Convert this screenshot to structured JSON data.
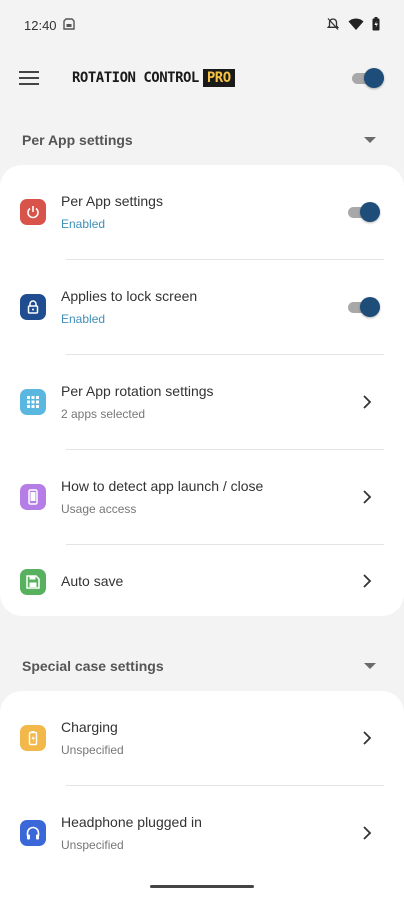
{
  "status": {
    "time": "12:40",
    "left_icon": "sd-card-icon",
    "right_icons": [
      "notifications-off-icon",
      "wifi-icon",
      "battery-icon"
    ]
  },
  "app_bar": {
    "menu_icon": "hamburger-menu-icon",
    "logo_text": "ROTATION CONTROL",
    "logo_badge": "PRO",
    "master_switch_on": true
  },
  "colors": {
    "switch_on": "#1e4d7a",
    "enabled_text": "#3f8fb7",
    "power": "#d8534a",
    "lock": "#1f4d8f",
    "grid": "#5ab7e0",
    "phone": "#b57ee6",
    "save": "#58b15f",
    "charging": "#f2b84a",
    "headphone": "#3a68d8"
  },
  "sections": {
    "per_app": {
      "header": "Per App settings",
      "rows": [
        {
          "title": "Per App settings",
          "subtitle": "Enabled",
          "icon": "power-icon",
          "control": "switch",
          "on": true
        },
        {
          "title": "Applies to lock screen",
          "subtitle": "Enabled",
          "icon": "lock-icon",
          "control": "switch",
          "on": true
        },
        {
          "title": "Per App rotation settings",
          "subtitle": "2 apps selected",
          "icon": "app-grid-icon",
          "control": "chevron"
        },
        {
          "title": "How to detect app launch / close",
          "subtitle": "Usage access",
          "icon": "phone-icon",
          "control": "chevron"
        },
        {
          "title": "Auto save",
          "icon": "save-icon",
          "control": "chevron"
        }
      ]
    },
    "special_case": {
      "header": "Special case settings",
      "rows": [
        {
          "title": "Charging",
          "subtitle": "Unspecified",
          "icon": "battery-charging-icon",
          "control": "chevron"
        },
        {
          "title": "Headphone plugged in",
          "subtitle": "Unspecified",
          "icon": "headphone-icon",
          "control": "chevron"
        }
      ]
    }
  }
}
